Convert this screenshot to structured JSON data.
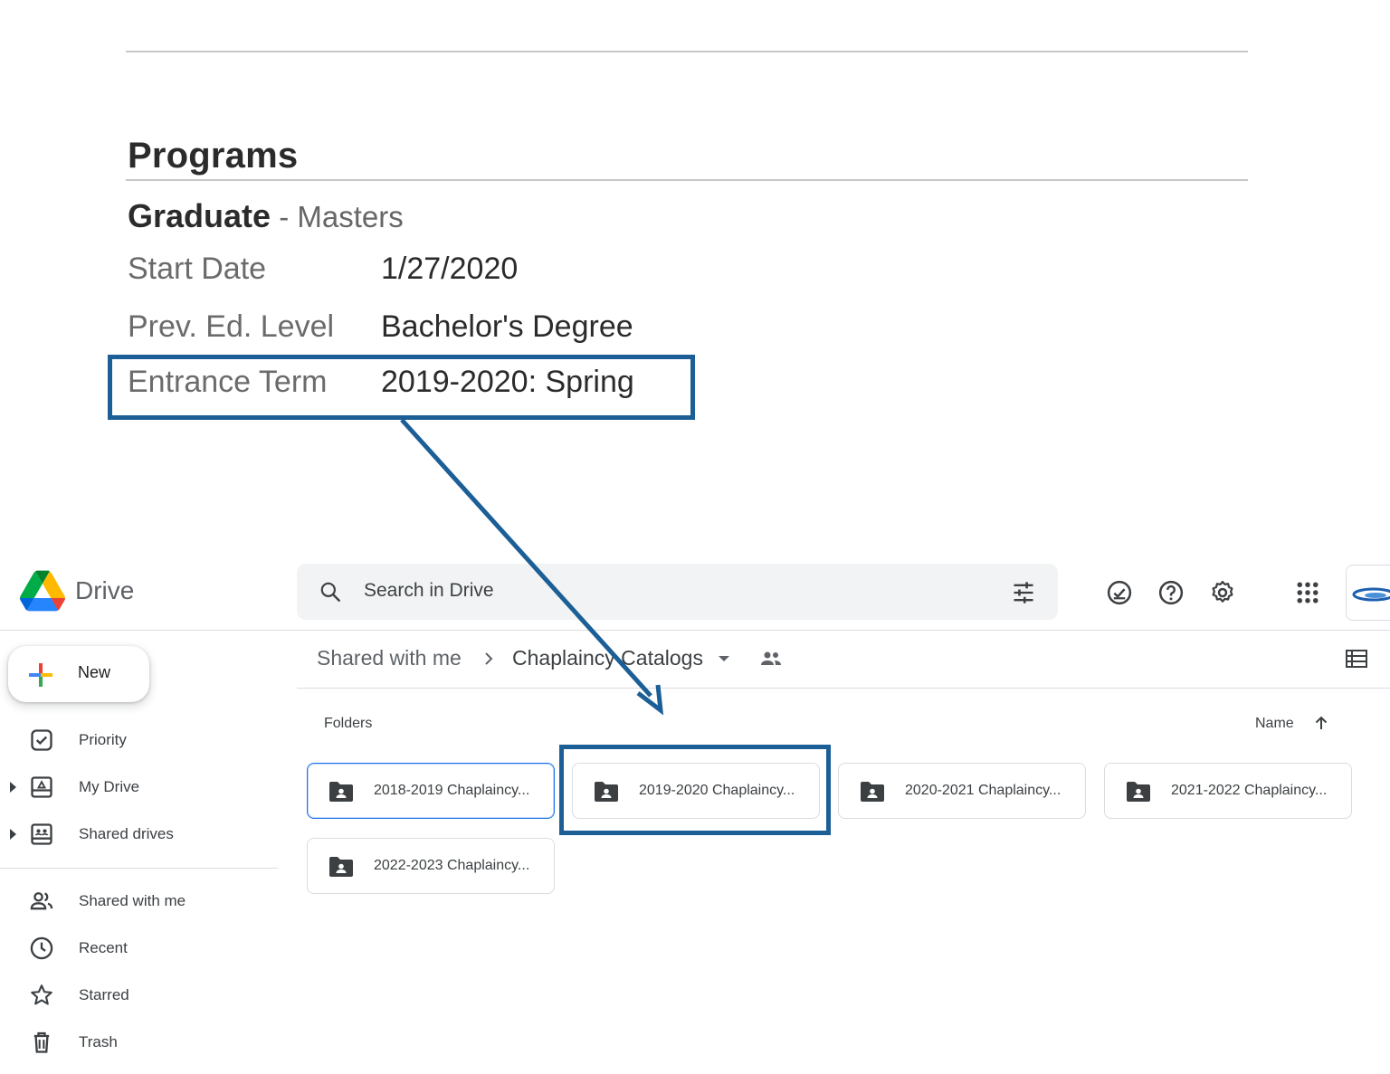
{
  "document": {
    "section_title": "Programs",
    "level": "Graduate",
    "level_separator": " - ",
    "degree": "Masters",
    "fields": [
      {
        "label": "Start Date",
        "value": "1/27/2020"
      },
      {
        "label": "Prev. Ed. Level",
        "value": "Bachelor's Degree"
      },
      {
        "label": "Entrance Term",
        "value": "2019-2020: Spring"
      }
    ]
  },
  "annotation": {
    "color": "#1c5f96"
  },
  "drive": {
    "app_name": "Drive",
    "search": {
      "placeholder": "Search in Drive",
      "value": ""
    },
    "header_icons": [
      "offline-ready-icon",
      "help-icon",
      "settings-icon",
      "apps-grid-icon"
    ],
    "new_button": "New",
    "nav_primary": [
      {
        "label": "Priority",
        "icon": "priority-icon"
      },
      {
        "label": "My Drive",
        "icon": "my-drive-icon"
      },
      {
        "label": "Shared drives",
        "icon": "shared-drives-icon"
      }
    ],
    "nav_secondary": [
      {
        "label": "Shared with me",
        "icon": "shared-with-me-icon"
      },
      {
        "label": "Recent",
        "icon": "recent-icon"
      },
      {
        "label": "Starred",
        "icon": "star-icon"
      },
      {
        "label": "Trash",
        "icon": "trash-icon"
      }
    ],
    "breadcrumb": {
      "root": "Shared with me",
      "current": "Chaplaincy Catalogs"
    },
    "folders_label": "Folders",
    "sort_label": "Name",
    "folders": [
      "2018-2019 Chaplaincy...",
      "2019-2020 Chaplaincy...",
      "2020-2021 Chaplaincy...",
      "2021-2022 Chaplaincy...",
      "2022-2023 Chaplaincy..."
    ],
    "accent": "#1a73e8"
  }
}
